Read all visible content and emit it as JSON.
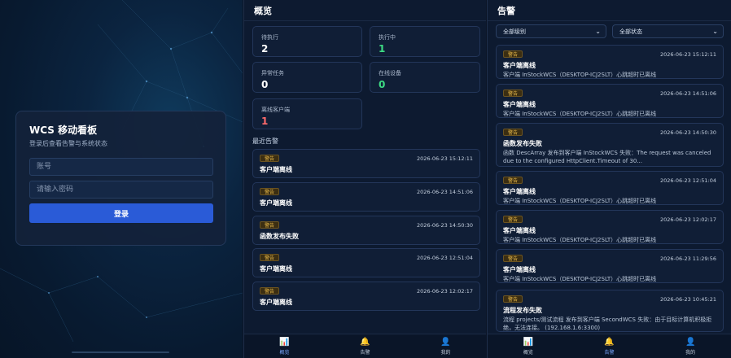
{
  "login": {
    "title": "WCS 移动看板",
    "subtitle": "登录后查看告警与系统状态",
    "username_placeholder": "账号",
    "password_placeholder": "请输入密码",
    "login_button": "登录"
  },
  "overview": {
    "title": "概览",
    "stats": [
      {
        "label": "待执行",
        "value": "2",
        "color": "#ffffff"
      },
      {
        "label": "执行中",
        "value": "1",
        "color": "#3ddc84"
      },
      {
        "label": "异常任务",
        "value": "0",
        "color": "#ffffff"
      },
      {
        "label": "在线设备",
        "value": "0",
        "color": "#3ddc84"
      },
      {
        "label": "离线客户端",
        "value": "1",
        "color": "#ff6b6b"
      }
    ],
    "recent_title": "最近告警",
    "recent": [
      {
        "badge": "警告",
        "time": "2026-06-23 15:12:11",
        "title": "客户端离线"
      },
      {
        "badge": "警告",
        "time": "2026-06-23 14:51:06",
        "title": "客户端离线"
      },
      {
        "badge": "警告",
        "time": "2026-06-23 14:50:30",
        "title": "函数发布失败"
      },
      {
        "badge": "警告",
        "time": "2026-06-23 12:51:04",
        "title": "客户端离线"
      },
      {
        "badge": "警告",
        "time": "2026-06-23 12:02:17",
        "title": "客户端离线"
      }
    ]
  },
  "alerts": {
    "title": "告警",
    "level_filter": "全部级别",
    "status_filter": "全部状态",
    "items": [
      {
        "badge": "警告",
        "time": "2026-06-23 15:12:11",
        "title": "客户端离线",
        "desc": "客户端 InStockWCS（DESKTOP-ICJ2SLT）心跳超时已离线"
      },
      {
        "badge": "警告",
        "time": "2026-06-23 14:51:06",
        "title": "客户端离线",
        "desc": "客户端 InStockWCS（DESKTOP-ICJ2SLT）心跳超时已离线"
      },
      {
        "badge": "警告",
        "time": "2026-06-23 14:50:30",
        "title": "函数发布失败",
        "desc": "函数 DescArray 发布到客户端 InStockWCS 失败：The request was canceled due to the configured HttpClient.Timeout of 30..."
      },
      {
        "badge": "警告",
        "time": "2026-06-23 12:51:04",
        "title": "客户端离线",
        "desc": "客户端 InStockWCS（DESKTOP-ICJ2SLT）心跳超时已离线"
      },
      {
        "badge": "警告",
        "time": "2026-06-23 12:02:17",
        "title": "客户端离线",
        "desc": "客户端 InStockWCS（DESKTOP-ICJ2SLT）心跳超时已离线"
      },
      {
        "badge": "警告",
        "time": "2026-06-23 11:29:56",
        "title": "客户端离线",
        "desc": "客户端 InStockWCS（DESKTOP-ICJ2SLT）心跳超时已离线"
      },
      {
        "badge": "警告",
        "time": "2026-06-23 10:45:21",
        "title": "流程发布失败",
        "desc": "流程 projects/测试流程 发布到客户端 SecondWCS 失败：由于目标计算机积极拒绝，无法连接。 (192.168.1.6:3300)"
      }
    ]
  },
  "tabs": [
    {
      "label": "概览",
      "icon": "chart-icon"
    },
    {
      "label": "告警",
      "icon": "bell-icon"
    },
    {
      "label": "我的",
      "icon": "user-icon"
    }
  ]
}
